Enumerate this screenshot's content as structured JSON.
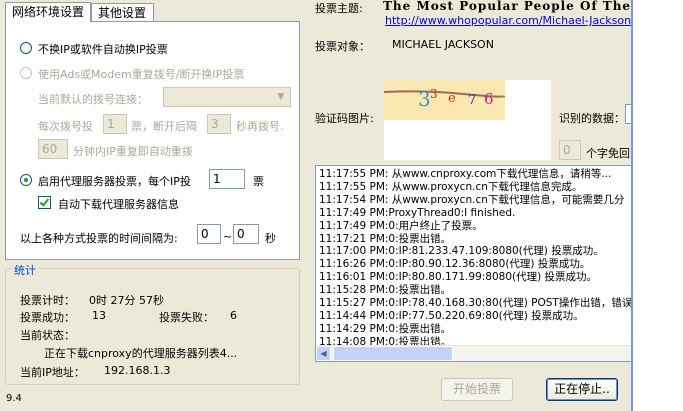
{
  "tabs": [
    {
      "label": "网络环境设置"
    },
    {
      "label": "其他设置"
    }
  ],
  "network": {
    "option1": "不换IP或软件自动换IP投票",
    "option2": "使用Ads或Modem重复拨号/断开换IP投票",
    "dial_label": "当前默认的拨号连接：",
    "dial_value": "",
    "every_label": "每次拨号投",
    "every_value": "1",
    "every_after": "票，断开后隔",
    "wait_value": "3",
    "wait_after": "秒再拨号.",
    "minutes_value": "60",
    "minutes_after": "分钟内IP重复即自动重拨",
    "proxy_label": "启用代理服务器投票，每个IP投",
    "proxy_value": "1",
    "proxy_unit": "票",
    "auto_download": "自动下载代理服务器信息",
    "interval_label": "以上各种方式投票的时间间隔为:",
    "interval_min": "0",
    "interval_sep": "~",
    "interval_max": "0",
    "interval_unit": "秒"
  },
  "stats": {
    "title": "统计",
    "timer_label": "投票计时：",
    "timer_value": "0时 27分 57秒",
    "success_label": "投票成功：",
    "success_value": "13",
    "fail_label": "投票失败：",
    "fail_value": "6",
    "status_label": "当前状态：",
    "status_value": "正在下载cnproxy的代理服务器列表4...",
    "ip_label": "当前IP地址：",
    "ip_value": "192.168.1.3"
  },
  "version": "9.4",
  "vote": {
    "theme_label": "投票主题:",
    "theme_value": "The Most Popular People Of The W",
    "link": "http://www.whopopular.com/Michael-Jackson",
    "target_label": "投票对象：",
    "target_value": "MICHAEL JACKSON",
    "captcha_label": "验证码图片:",
    "captcha_text": "3e76",
    "recognized_label": "识别的数据：",
    "count_value": "0",
    "count_after": "个字免回"
  },
  "log": [
    "11:17:55 PM: 从www.cnproxy.com下载代理信息，请稍等...",
    "11:17:55 PM: 从www.proxycn.cn下载代理信息完成。",
    "11:17:54 PM: 从www.proxycn.cn下载代理信息，可能需要几分",
    "11:17:49 PM:ProxyThread0:I finished.",
    "11:17:49 PM:0:用户终止了投票。",
    "11:17:21 PM:0:投票出错。",
    "11:17:00 PM:0:IP:81.233.47.109:8080(代理) 投票成功。",
    "11:16:26 PM:0:IP:80.90.12.36:8080(代理) 投票成功。",
    "11:16:01 PM:0:IP:80.80.171.99:8080(代理) 投票成功。",
    "11:15:28 PM:0:投票出错。",
    "11:15:27 PM:0:IP:78.40.168.30:80(代理) POST操作出错，错误(",
    "11:14:44 PM:0:IP:77.50.220.69:80(代理) 投票成功。",
    "11:14:29 PM:0:投票出错。",
    "11:14:08 PM:0:投票出错。"
  ],
  "buttons": {
    "start": "开始投票",
    "stop": "正在停止.."
  }
}
